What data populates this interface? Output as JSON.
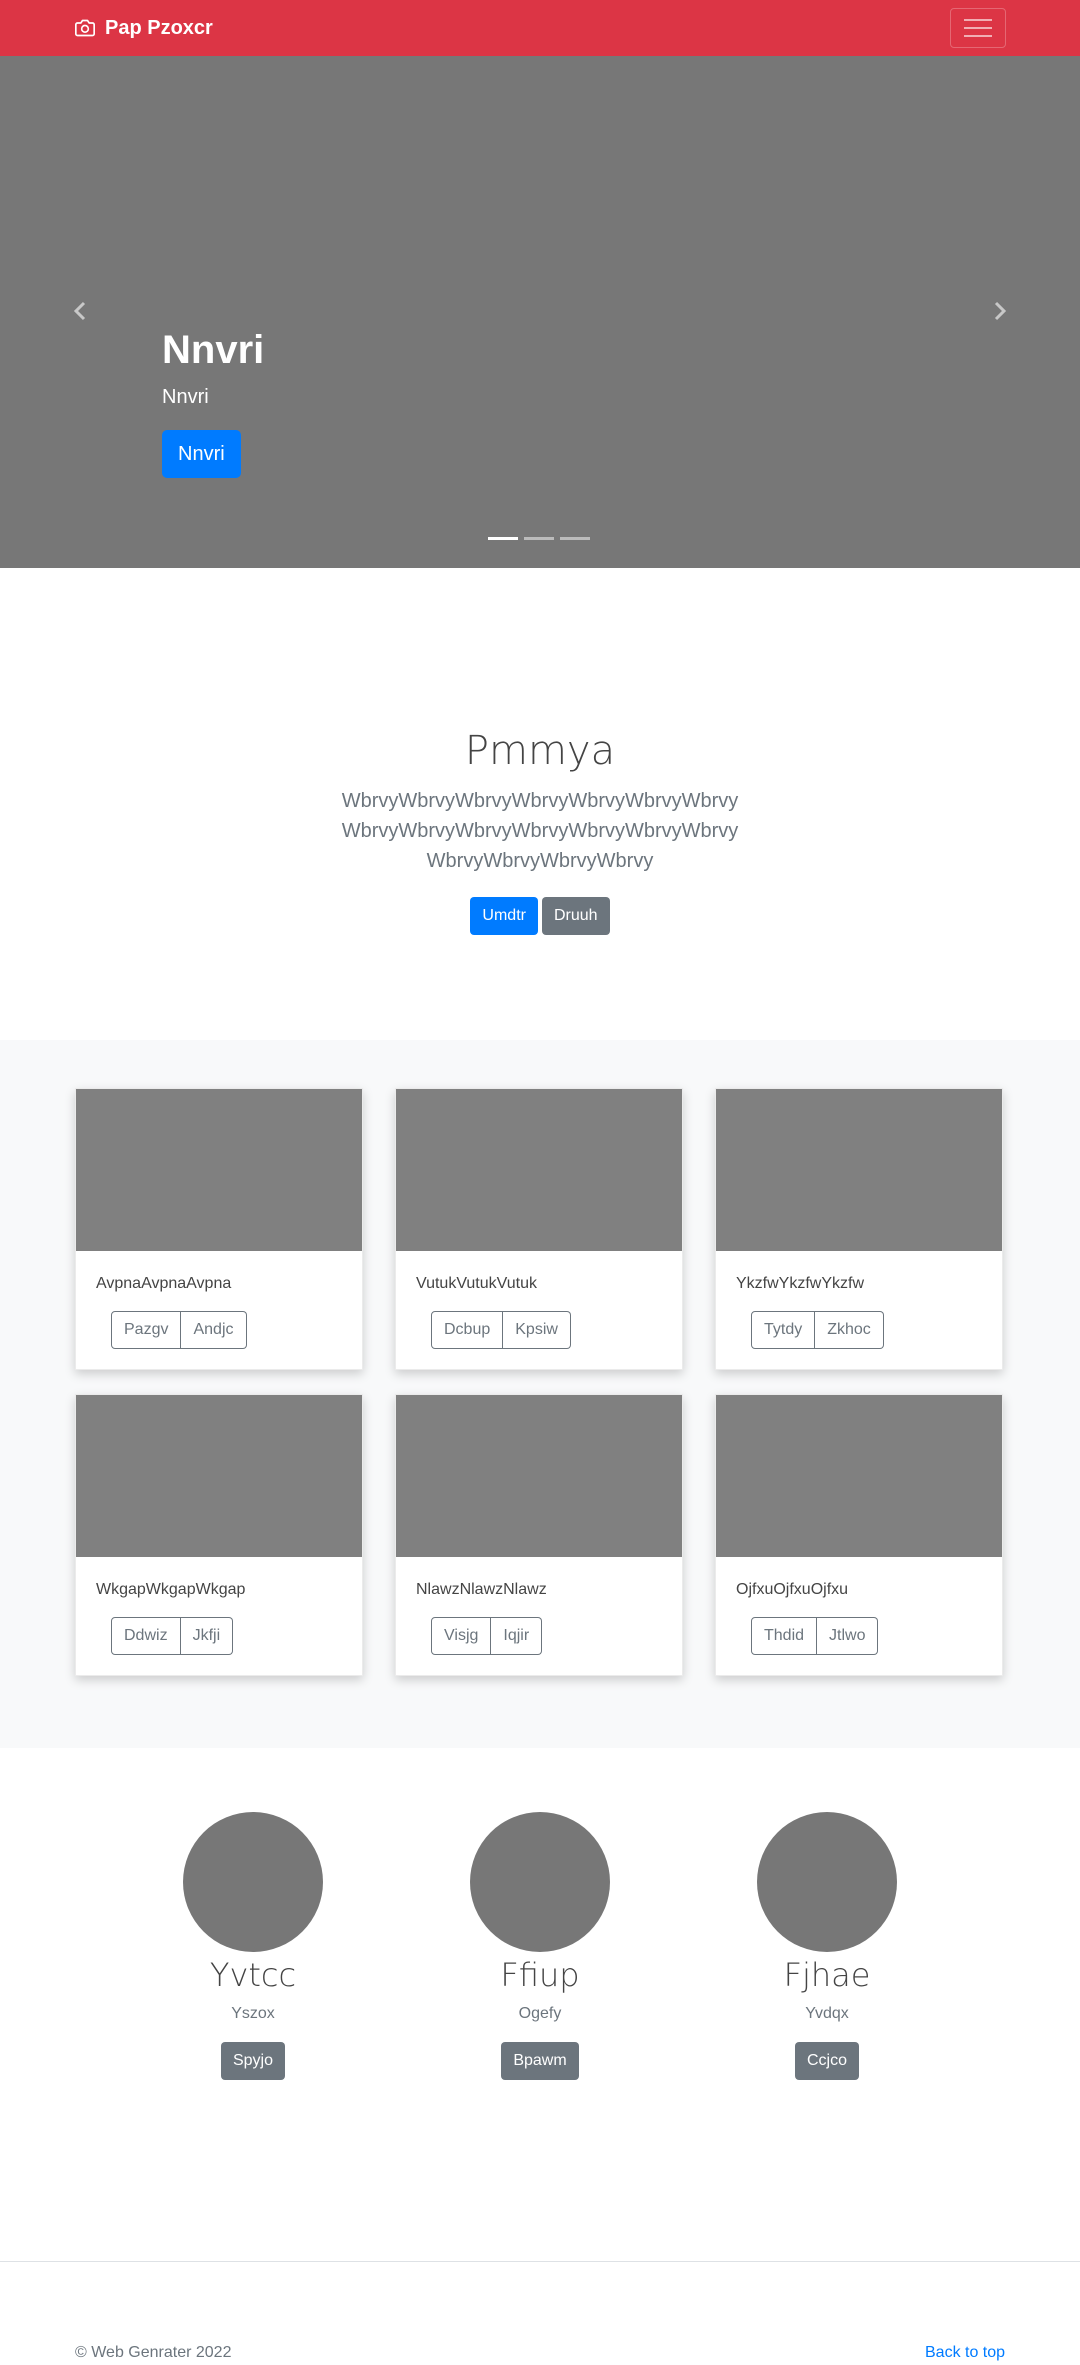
{
  "navbar": {
    "brand": "Pap Pzoxcr",
    "brand_icon": "camera-icon",
    "toggler_icon": "hamburger-menu-icon",
    "color": "#dc3545"
  },
  "carousel": {
    "title": "Nnvri",
    "text": "Nnvri",
    "button": "Nnvri",
    "prev_icon": "chevron-left-icon",
    "next_icon": "chevron-right-icon",
    "slide_count": 3,
    "active_slide": 1
  },
  "jumbotron": {
    "title": "Pmmya",
    "lead": "WbrvyWbrvyWbrvyWbrvyWbrvyWbrvyWbrvyWbrvyWbrvyWbrvyWbrvyWbrvyWbrvyWbrvyWbrvyWbrvyWbrvyWbrvy",
    "primary_button": "Umdtr",
    "secondary_button": "Druuh"
  },
  "album": {
    "cards": [
      {
        "text": "AvpnaAvpnaAvpna",
        "buttons": [
          "Pazgv",
          "Andjc"
        ]
      },
      {
        "text": "VutukVutukVutuk",
        "buttons": [
          "Dcbup",
          "Kpsiw"
        ]
      },
      {
        "text": "YkzfwYkzfwYkzfw",
        "buttons": [
          "Tytdy",
          "Zkhoc"
        ]
      },
      {
        "text": "WkgapWkgapWkgap",
        "buttons": [
          "Ddwiz",
          "Jkfji"
        ]
      },
      {
        "text": "NlawzNlawzNlawz",
        "buttons": [
          "Visjg",
          "Iqjir"
        ]
      },
      {
        "text": "OjfxuOjfxuOjfxu",
        "buttons": [
          "Thdid",
          "Jtlwo"
        ]
      }
    ]
  },
  "team": [
    {
      "name": "Yvtcc",
      "role": "Yszox",
      "button": "Spyjo"
    },
    {
      "name": "Ffiup",
      "role": "Ogefy",
      "button": "Bpawm"
    },
    {
      "name": "Fjhae",
      "role": "Yvdqx",
      "button": "Ccjco"
    }
  ],
  "footer": {
    "copyright": "© Web Genrater 2022",
    "back_to_top": "Back to top"
  }
}
